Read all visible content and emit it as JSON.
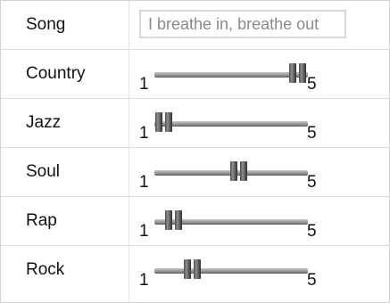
{
  "song": {
    "label": "Song",
    "placeholder": "I breathe in, breathe out"
  },
  "sliders": [
    {
      "label": "Country",
      "min_label": "1",
      "max_label": "5",
      "min": 1,
      "max": 5,
      "value": 4.75
    },
    {
      "label": "Jazz",
      "min_label": "1",
      "max_label": "5",
      "min": 1,
      "max": 5,
      "value": 1.25
    },
    {
      "label": "Soul",
      "min_label": "1",
      "max_label": "5",
      "min": 1,
      "max": 5,
      "value": 3.2
    },
    {
      "label": "Rap",
      "min_label": "1",
      "max_label": "5",
      "min": 1,
      "max": 5,
      "value": 1.5
    },
    {
      "label": "Rock",
      "min_label": "1",
      "max_label": "5",
      "min": 1,
      "max": 5,
      "value": 2.0
    }
  ]
}
